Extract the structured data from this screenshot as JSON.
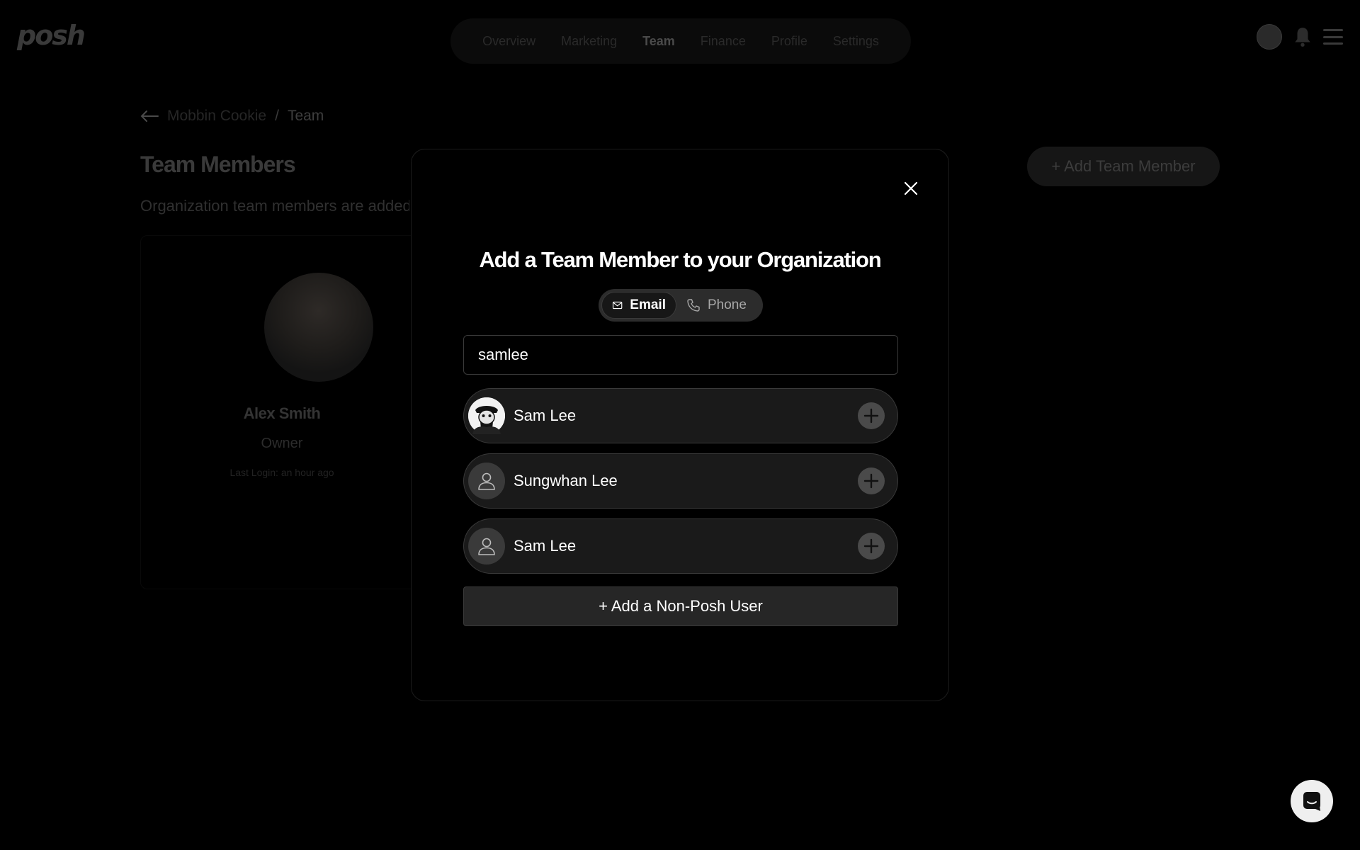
{
  "app": {
    "logo_text": "posh"
  },
  "nav": {
    "items": [
      {
        "label": "Overview"
      },
      {
        "label": "Marketing"
      },
      {
        "label": "Team",
        "active": true
      },
      {
        "label": "Finance"
      },
      {
        "label": "Profile"
      },
      {
        "label": "Settings"
      }
    ]
  },
  "breadcrumb": {
    "org": "Mobbin Cookie",
    "separator": "/",
    "current": "Team"
  },
  "page": {
    "title": "Team Members",
    "subtitle": "Organization team members are added t",
    "add_button": "+ Add Team Member"
  },
  "member_card": {
    "name": "Alex Smith",
    "role": "Owner",
    "last_login": "Last Login: an hour ago"
  },
  "modal": {
    "title": "Add a Team Member to your Organization",
    "toggle": {
      "email": "Email",
      "phone": "Phone",
      "selected": "email"
    },
    "search_value": "samlee",
    "results": [
      {
        "name": "Sam Lee",
        "avatar": "photo"
      },
      {
        "name": "Sungwhan Lee",
        "avatar": "default-user-icon"
      },
      {
        "name": "Sam Lee",
        "avatar": "default-user-icon"
      }
    ],
    "add_non_posh_button": "+ Add a Non-Posh User"
  },
  "colors": {
    "background": "#000000",
    "modal_border": "#1c1c1c",
    "result_bg": "#1a1a1a",
    "accent": "#ffffff"
  },
  "icons": [
    "back-arrow-icon",
    "bell-icon",
    "menu-icon",
    "close-icon",
    "mail-icon",
    "phone-icon",
    "user-icon",
    "plus-icon",
    "chat-icon"
  ]
}
